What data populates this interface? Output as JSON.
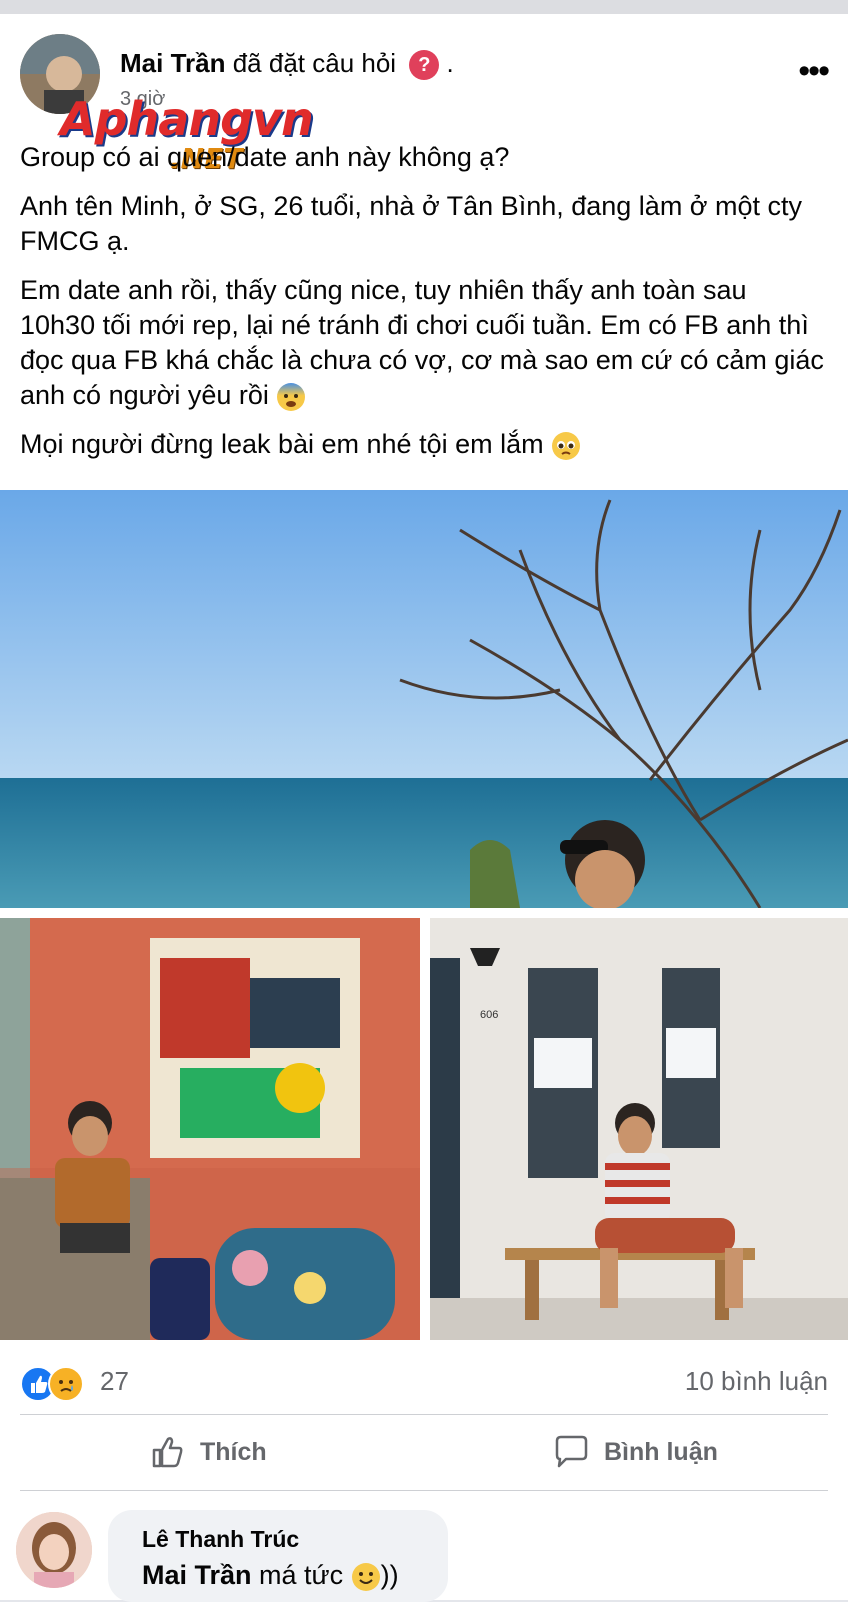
{
  "post": {
    "author": "Mai Trần",
    "action": "đã đặt câu hỏi",
    "badge_icon": "?",
    "trailing": ".",
    "time": "3 giờ",
    "more_label": "•••",
    "watermark": {
      "line1": "Aphangvn",
      "line2": ".NET"
    },
    "paragraphs": [
      "Group có ai quen/date anh này không ạ?",
      "Anh tên Minh, ở SG, 26 tuổi, nhà ở Tân Bình, đang làm ở một cty FMCG ạ.",
      "Em date anh rồi, thấy cũng nice, tuy nhiên thấy anh toàn sau 10h30 tối mới rep, lại né tránh đi chơi cuối tuần. Em có FB anh thì đọc qua FB khá chắc là chưa có vợ, cơ mà sao em cứ có cảm giác anh có người yêu rồi",
      "Mọi người đừng leak bài em nhé tội em lắm"
    ],
    "photo_labels": {
      "door_number": "606"
    }
  },
  "reactions": {
    "count": "27",
    "comments_count": "10 bình luận",
    "icons": [
      "like-icon",
      "sad-icon"
    ]
  },
  "actions": {
    "like_label": "Thích",
    "comment_label": "Bình luận"
  },
  "comment": {
    "author": "Lê Thanh Trúc",
    "mention": "Mai Trần",
    "text": "má tức",
    "suffix": "))"
  },
  "colors": {
    "brand_blue": "#1877f2",
    "text_secondary": "#65676b",
    "badge_pink": "#e0405b",
    "sad_yellow": "#f7b125"
  }
}
